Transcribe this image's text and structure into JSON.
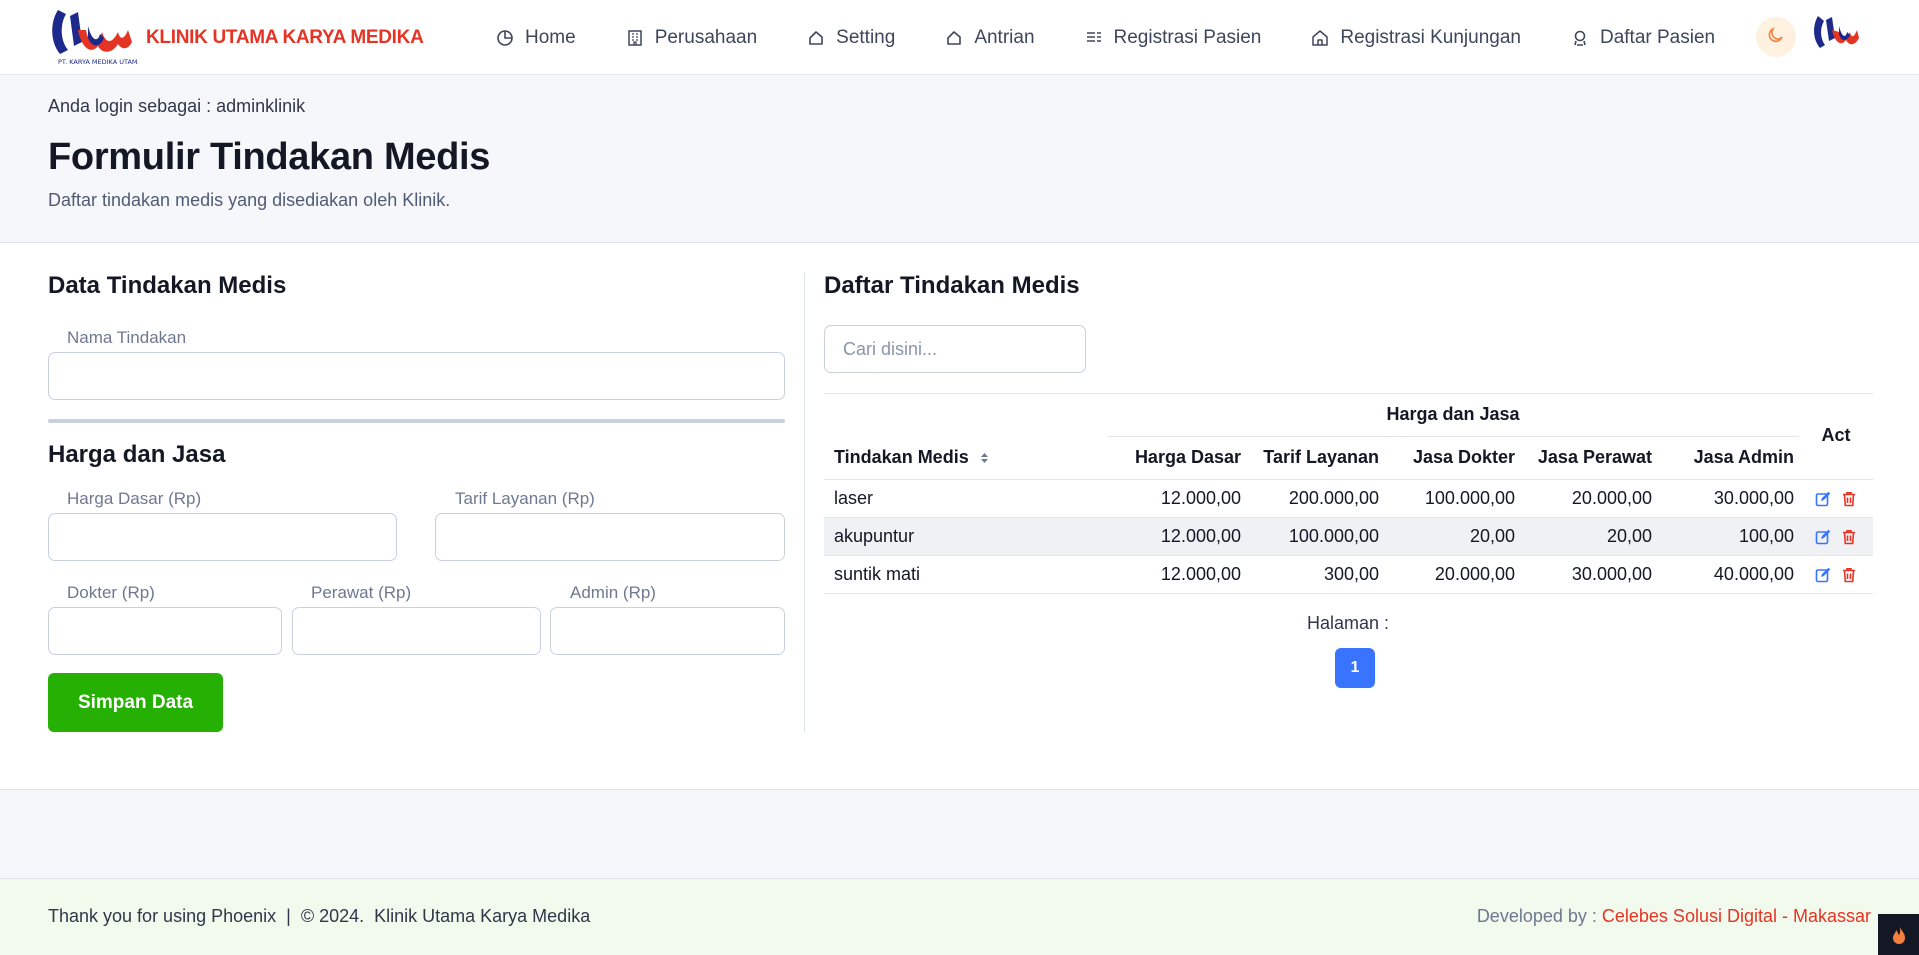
{
  "brand": {
    "name": "KLINIK UTAMA KARYA MEDIKA",
    "logo_caption": "PT. KARYA MEDIKA UTAMA"
  },
  "nav": {
    "items": [
      {
        "label": "Home",
        "icon": "pie-chart-icon"
      },
      {
        "label": "Perusahaan",
        "icon": "building-icon"
      },
      {
        "label": "Setting",
        "icon": "tag-icon"
      },
      {
        "label": "Antrian",
        "icon": "tag-icon"
      },
      {
        "label": "Registrasi Pasien",
        "icon": "list-icon"
      },
      {
        "label": "Registrasi Kunjungan",
        "icon": "home-icon"
      },
      {
        "label": "Daftar Pasien",
        "icon": "user-badge-icon"
      }
    ],
    "theme_icon": "moon-icon"
  },
  "header": {
    "login_info": "Anda login sebagai : adminklinik",
    "title": "Formulir Tindakan Medis",
    "subtitle": "Daftar tindakan medis yang disediakan oleh Klinik."
  },
  "form": {
    "section_title": "Data Tindakan Medis",
    "nama_label": "Nama Tindakan",
    "nama_value": "",
    "harga_section_title": "Harga dan Jasa",
    "harga_dasar_label": "Harga Dasar (Rp)",
    "tarif_layanan_label": "Tarif Layanan (Rp)",
    "dokter_label": "Dokter (Rp)",
    "perawat_label": "Perawat (Rp)",
    "admin_label": "Admin (Rp)",
    "save_label": "Simpan Data"
  },
  "list": {
    "section_title": "Daftar Tindakan Medis",
    "search_placeholder": "Cari disini...",
    "group_header": "Harga dan Jasa",
    "columns": {
      "tindakan": "Tindakan Medis",
      "harga_dasar": "Harga Dasar",
      "tarif_layanan": "Tarif Layanan",
      "jasa_dokter": "Jasa Dokter",
      "jasa_perawat": "Jasa Perawat",
      "jasa_admin": "Jasa Admin",
      "act": "Act"
    },
    "rows": [
      {
        "tindakan": "laser",
        "harga_dasar": "12.000,00",
        "tarif_layanan": "200.000,00",
        "jasa_dokter": "100.000,00",
        "jasa_perawat": "20.000,00",
        "jasa_admin": "30.000,00"
      },
      {
        "tindakan": "akupuntur",
        "harga_dasar": "12.000,00",
        "tarif_layanan": "100.000,00",
        "jasa_dokter": "20,00",
        "jasa_perawat": "20,00",
        "jasa_admin": "100,00"
      },
      {
        "tindakan": "suntik mati",
        "harga_dasar": "12.000,00",
        "tarif_layanan": "300,00",
        "jasa_dokter": "20.000,00",
        "jasa_perawat": "30.000,00",
        "jasa_admin": "40.000,00"
      }
    ],
    "pager_label": "Halaman :",
    "current_page": "1"
  },
  "footer": {
    "left": "Thank you for using Phoenix  |  © 2024.  Klinik Utama Karya Medika",
    "right_prefix": "Developed by : ",
    "right_link": "Celebes Solusi Digital - Makassar"
  },
  "colors": {
    "brand_red": "#e63424",
    "save_green": "#25b003",
    "primary_blue": "#3874ff",
    "footer_bg": "#f1faec"
  }
}
